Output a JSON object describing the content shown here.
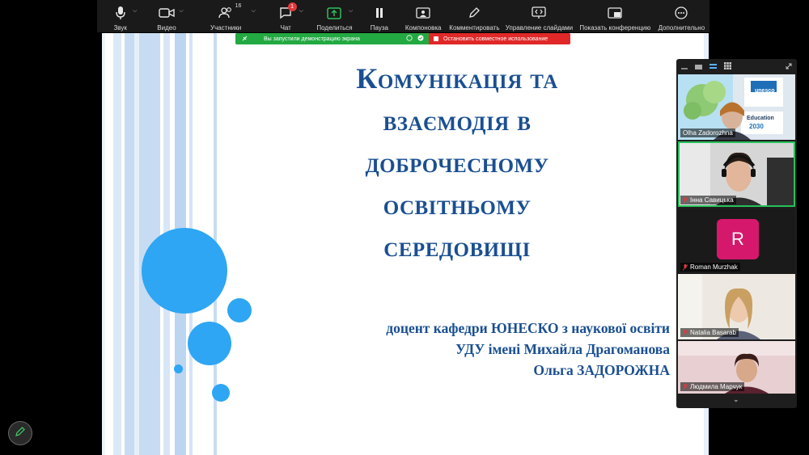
{
  "toolbar": {
    "items": [
      {
        "label": "Звук",
        "icon": "microphone-icon"
      },
      {
        "label": "Видео",
        "icon": "video-camera-icon"
      },
      {
        "label": "Участники",
        "icon": "participants-icon",
        "count": "16"
      },
      {
        "label": "Чат",
        "icon": "chat-icon",
        "badge": "1"
      },
      {
        "label": "Поделиться",
        "icon": "share-screen-icon"
      },
      {
        "label": "Пауза",
        "icon": "pause-icon"
      },
      {
        "label": "Компоновка",
        "icon": "layout-icon"
      },
      {
        "label": "Комментировать",
        "icon": "pen-icon"
      },
      {
        "label": "Управление слайдами",
        "icon": "slides-control-icon"
      },
      {
        "label": "Показать конференцию",
        "icon": "show-meeting-icon"
      },
      {
        "label": "Дополнительно",
        "icon": "more-icon"
      }
    ]
  },
  "share": {
    "status": "Вы запустили демонстрацию экрана",
    "stop": "Остановить совместное использование",
    "green_color": "#23a942",
    "red_color": "#e02828"
  },
  "slide": {
    "title_lines": [
      "Комунікація та",
      "взаємодія в",
      "доброчесному",
      "освітньому",
      "середовищі"
    ],
    "author_lines": [
      "доцент кафедри ЮНЕСКО з наукової освіти",
      "УДУ імені Михайла Драгоманова",
      "Ольга ЗАДОРОЖНА"
    ],
    "title_color": "#1a4f92",
    "circle_color": "#2ea6f3"
  },
  "gallery": {
    "tiles": [
      {
        "name": "Olha Zadorozhna",
        "muted": false,
        "logo1": "unesco",
        "logo2": "Education",
        "logo3": "2030"
      },
      {
        "name": "Інна Савицька",
        "muted": true
      },
      {
        "name": "Roman Murzhak",
        "muted": true,
        "initial": "R"
      },
      {
        "name": "Natalia Basarab",
        "muted": true
      },
      {
        "name": "Людмила Марчук",
        "muted": true
      }
    ]
  }
}
